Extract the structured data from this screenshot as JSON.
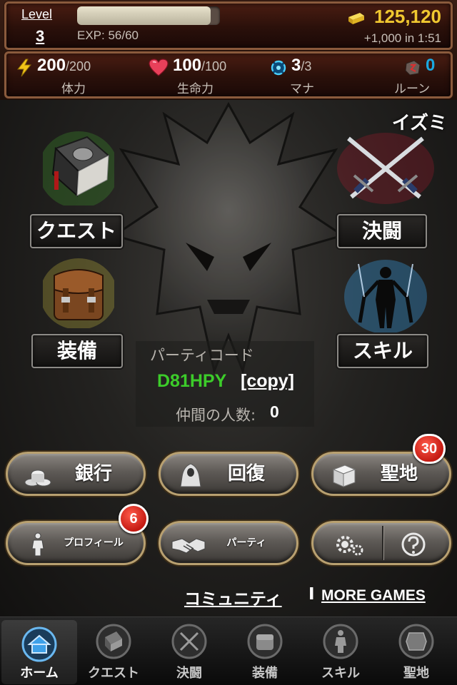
{
  "status": {
    "level_label": "Level",
    "level_value": "3",
    "exp_text": "EXP: 56/60",
    "exp_fraction": 0.933,
    "gold": "125,120",
    "gold_timer": "+1,000 in 1:51"
  },
  "stats": [
    {
      "value": "200",
      "max": "/200",
      "label": "体力",
      "icon": "lightning-icon"
    },
    {
      "value": "100",
      "max": "/100",
      "label": "生命力",
      "icon": "heart-icon"
    },
    {
      "value": "3",
      "max": "/3",
      "label": "マナ",
      "icon": "mana-swirl-icon"
    },
    {
      "value": "0",
      "max": "",
      "label": "ルーン",
      "icon": "rune-stone-icon"
    }
  ],
  "player_name": "イズミ",
  "menu": {
    "quest": "クエスト",
    "duel": "決闘",
    "equipment": "装備",
    "skill": "スキル"
  },
  "party": {
    "title": "パーティコード",
    "code": "D81HPY",
    "copy": "[copy]",
    "count_label": "仲間の人数:",
    "count": "0"
  },
  "buttons": {
    "bank": "銀行",
    "recover": "回復",
    "sanctuary": "聖地",
    "sanctuary_badge": "30",
    "profile": "プロフィール",
    "profile_badge": "6",
    "party": "パーティ"
  },
  "links": {
    "community": "コミュニティ",
    "separator": "I",
    "more_games": "MORE GAMES"
  },
  "tabs": [
    {
      "label": "ホーム",
      "active": true
    },
    {
      "label": "クエスト",
      "active": false
    },
    {
      "label": "決闘",
      "active": false
    },
    {
      "label": "装備",
      "active": false
    },
    {
      "label": "スキル",
      "active": false
    },
    {
      "label": "聖地",
      "active": false
    }
  ],
  "colors": {
    "gold": "#f0c830",
    "party_code": "#3ccc2a",
    "badge": "#c41a12",
    "mana": "#1aa8e0"
  }
}
